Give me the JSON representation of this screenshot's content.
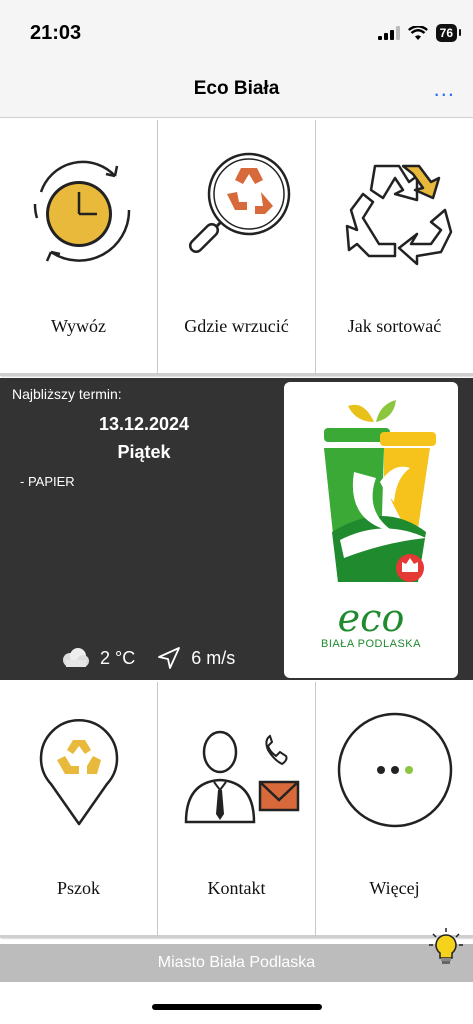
{
  "status": {
    "time": "21:03",
    "battery": "76"
  },
  "nav": {
    "title": "Eco Biała",
    "more_label": "..."
  },
  "tiles_top": [
    {
      "label": "Wywóz",
      "icon": "clock-cycle-icon"
    },
    {
      "label": "Gdzie wrzucić",
      "icon": "magnifier-recycle-icon"
    },
    {
      "label": "Jak sortować",
      "icon": "recycle-arrows-icon"
    }
  ],
  "next_collection": {
    "heading": "Najbliższy termin:",
    "date": "13.12.2024",
    "day": "Piątek",
    "type": "- PAPIER",
    "weather": {
      "temperature": "2 °C",
      "wind": "6 m/s",
      "weather_icon": "cloud-icon",
      "wind_icon": "navigation-arrow-icon"
    },
    "logo": {
      "word": "eco",
      "subtitle": "BIAŁA PODLASKA"
    }
  },
  "tiles_bottom": [
    {
      "label": "Pszok",
      "icon": "map-pin-recycle-icon"
    },
    {
      "label": "Kontakt",
      "icon": "person-phone-mail-icon"
    },
    {
      "label": "Więcej",
      "icon": "more-dots-icon"
    }
  ],
  "footer": {
    "text": "Miasto Biała Podlaska",
    "icon": "lightbulb-icon"
  },
  "colors": {
    "accent_yellow": "#e8b93a",
    "orange": "#d8693a",
    "green": "#1f8a2e",
    "panel_dark": "#333333",
    "link_blue": "#2f6df6"
  }
}
